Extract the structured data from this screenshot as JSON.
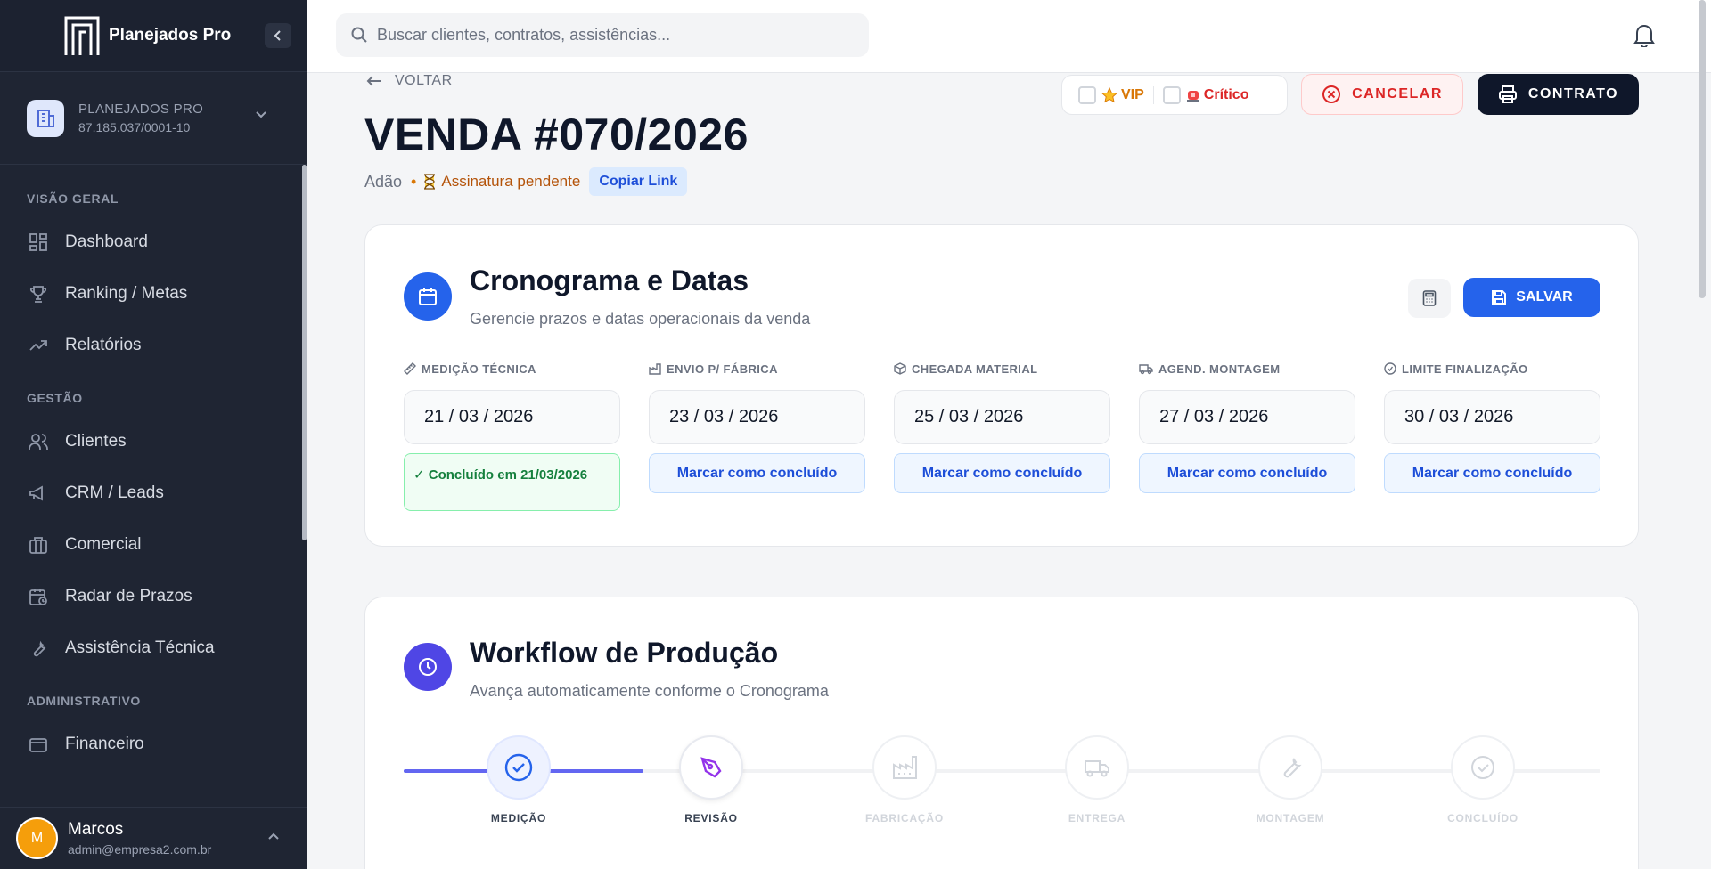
{
  "sidebar": {
    "brand": "Planejados Pro",
    "company": {
      "name": "PLANEJADOS PRO",
      "cnpj": "87.185.037/0001-10"
    },
    "sections": [
      {
        "label": "VISÃO GERAL",
        "items": [
          "Dashboard",
          "Ranking / Metas",
          "Relatórios"
        ]
      },
      {
        "label": "GESTÃO",
        "items": [
          "Clientes",
          "CRM / Leads",
          "Comercial",
          "Radar de Prazos",
          "Assistência Técnica"
        ]
      },
      {
        "label": "ADMINISTRATIVO",
        "items": [
          "Financeiro"
        ]
      }
    ],
    "user": {
      "initial": "M",
      "name": "Marcos",
      "email": "admin@empresa2.com.br"
    }
  },
  "header": {
    "search_placeholder": "Buscar clientes, contratos, assistências..."
  },
  "page": {
    "back_label": "VOLTAR",
    "title": "VENDA #070/2026",
    "client": "Adão",
    "status": "Assinatura pendente",
    "copy_link": "Copiar Link",
    "flags": {
      "vip": "VIP",
      "critical": "Crítico"
    },
    "cancel_label": "CANCELAR",
    "contract_label": "CONTRATO"
  },
  "schedule": {
    "title": "Cronograma e Datas",
    "subtitle": "Gerencie prazos e datas operacionais da venda",
    "save_label": "SALVAR",
    "dates": [
      {
        "label": "MEDIÇÃO TÉCNICA",
        "value": "21 / 03 / 2026",
        "done": true,
        "status": "✓ Concluído em 21/03/2026"
      },
      {
        "label": "ENVIO P/ FÁBRICA",
        "value": "23 / 03 / 2026",
        "done": false,
        "status": "Marcar como concluído"
      },
      {
        "label": "CHEGADA MATERIAL",
        "value": "25 / 03 / 2026",
        "done": false,
        "status": "Marcar como concluído"
      },
      {
        "label": "AGEND. MONTAGEM",
        "value": "27 / 03 / 2026",
        "done": false,
        "status": "Marcar como concluído"
      },
      {
        "label": "LIMITE FINALIZAÇÃO",
        "value": "30 / 03 / 2026",
        "done": false,
        "status": "Marcar como concluído"
      }
    ]
  },
  "workflow": {
    "title": "Workflow de Produção",
    "subtitle": "Avança automaticamente conforme o Cronograma",
    "steps": [
      {
        "label": "MEDIÇÃO",
        "state": "done"
      },
      {
        "label": "REVISÃO",
        "state": "current"
      },
      {
        "label": "FABRICAÇÃO",
        "state": "pending"
      },
      {
        "label": "ENTREGA",
        "state": "pending"
      },
      {
        "label": "MONTAGEM",
        "state": "pending"
      },
      {
        "label": "CONCLUÍDO",
        "state": "pending"
      }
    ],
    "progress_fraction": 0.2
  },
  "colors": {
    "sidebar_bg": "#1f2533",
    "accent_blue": "#2563eb",
    "workflow_purple": "#6366f1",
    "danger": "#dc2626"
  }
}
